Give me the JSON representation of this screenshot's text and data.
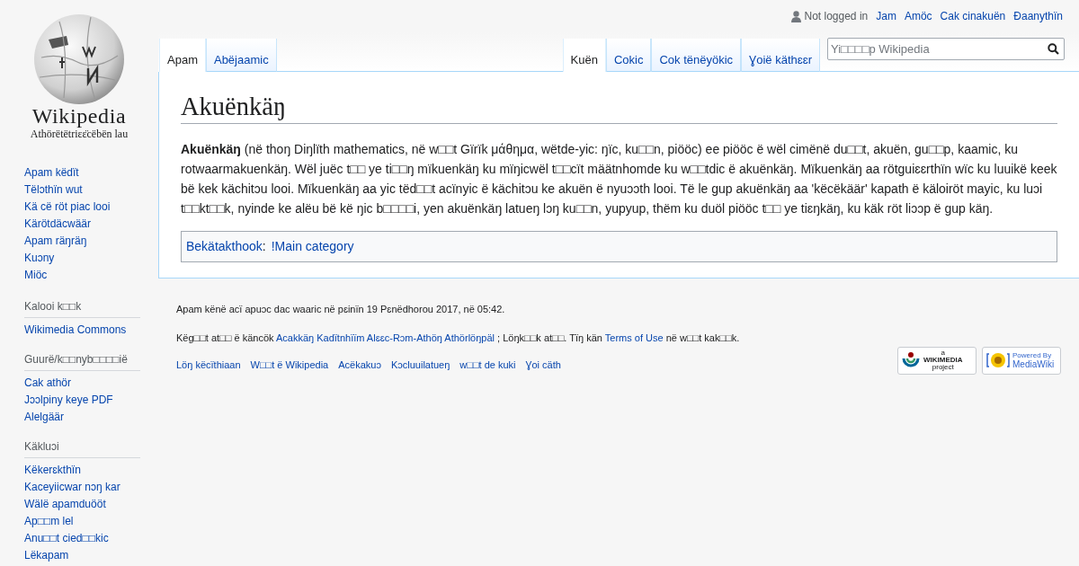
{
  "logo": {
    "wordmark": "Wikipedia",
    "tagline": "Athörëtëtriɛɛ̈cëbën lau"
  },
  "personal_tools": {
    "status": "Not logged in",
    "links": [
      "Jam",
      "Amöc",
      "Cak cinakuën",
      "Ɖaanythïn"
    ]
  },
  "left_tabs": [
    {
      "label": "Apam",
      "selected": true
    },
    {
      "label": "Abëjaamic",
      "selected": false
    }
  ],
  "right_tabs": [
    {
      "label": "Kuën",
      "selected": true
    },
    {
      "label": "Cokic",
      "selected": false
    },
    {
      "label": "Cok tënëyökic",
      "selected": false
    },
    {
      "label": "Ɣoië käthɛɛr",
      "selected": false
    }
  ],
  "search": {
    "placeholder": "Yi□□□□p Wikipedia"
  },
  "sidebar": [
    {
      "items": [
        "Apam këdït",
        "Tëlɔthïn wut",
        "Kä cë röt piac looi",
        "Kärötdäcwäär",
        "Apam räŋräŋ",
        "Kuɔny",
        "Miöc"
      ]
    },
    {
      "heading": "Kalooi k□□k",
      "items": [
        "Wikimedia Commons"
      ]
    },
    {
      "heading": "Guurë/k□□nyb□□□□iё",
      "items": [
        "Cak athör",
        "Jɔɔlpiny keye PDF",
        "Alelgäär"
      ]
    },
    {
      "heading": "Käkluɔi",
      "items": [
        "Këkerɛkthïn",
        "Kaceyiicwar nɔŋ kar",
        "Wälë apamduööt",
        "Ap□□m lel",
        "Anu□□t cied□□kic",
        "Lëkapam"
      ]
    }
  ],
  "article": {
    "title": "Akuënkäŋ",
    "body": "**Akuënkäŋ** (në thoŋ Diŋlïth mathematics, në w□□t Gïrïk μάθημα, wëtde-yic: ŋïc, ku□□n, piööc) ee piööc ë wël cimënë du□□t, akuën, gu□□p, kaamic, ku rotwaarmakuenkäŋ. Wël juëc t□□ ye ti□□ŋ mïkuenkäŋ ku mïŋicwël t□□cït määtnhomde ku w□□tdic ë akuënkäŋ. Mïkuenkäŋ aa rötguiɛɛrthïn wïc ku luuikë keek bë kek kächitɔu looi. Mïkuenkäŋ aa yic tëd□□t acïnyic ë kächitɔu ke akuën ë nyuɔɔth looi. Të le gup akuënkäŋ aa 'këcëkäär' kapath ë käloiröt mayic, ku luɔi t□□kt□□k, nyinde ke alëu bë kë ŋic b□□□□i, yen akuënkäŋ latueŋ lɔŋ ku□□n, yupyup, thëm ku duöl piööc t□□ ye tiɛŋkäŋ, ku käk röt liɔɔp ë gup käŋ.",
    "categories_label": "Bekätakthook",
    "categories_separator": ":",
    "categories": [
      "!Main category"
    ]
  },
  "footer": {
    "last_edited": "Apam kënë acï apuɔc dac waaric në pɛinïn 19 Pɛnëdhorou 2017, në 05:42.",
    "license": [
      {
        "kind": "text",
        "text": "Këg□□t at□□ ë käncök "
      },
      {
        "kind": "link",
        "text": "Acakkäŋ Kadïtnhïïm Alɛɛc-Rɔm-Athöŋ Athörlöŋpäl"
      },
      {
        "kind": "text",
        "text": " ; Löŋk□□k at□□. Tïŋ kän "
      },
      {
        "kind": "link",
        "text": "Terms of Use"
      },
      {
        "kind": "text",
        "text": " në w□□t kak□□k."
      }
    ],
    "links": [
      "Löŋ këcïthiaan",
      "W□□t ë Wikipedia",
      "Acëkakuɔ",
      "Kɔcluuilatueŋ",
      "w□□t de kuki",
      "Ɣoi cäth"
    ],
    "badges": [
      {
        "kind": "wikimedia",
        "small": "a",
        "big": "WIKIMEDIA",
        "sub": "project"
      },
      {
        "kind": "mediawiki",
        "small": "Powered By",
        "big": "MediaWiki"
      }
    ]
  }
}
